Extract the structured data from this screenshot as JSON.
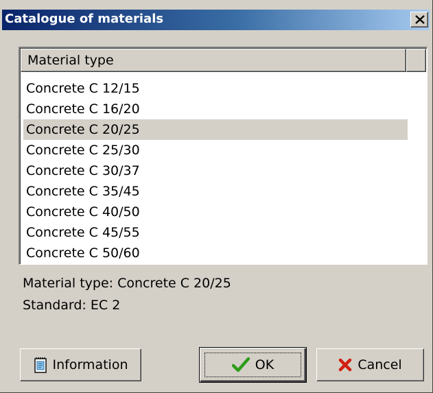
{
  "window": {
    "title": "Catalogue of materials"
  },
  "list": {
    "header": "Material type",
    "items": [
      "Concrete C 12/15",
      "Concrete C 16/20",
      "Concrete C 20/25",
      "Concrete C 25/30",
      "Concrete C 30/37",
      "Concrete C 35/45",
      "Concrete C 40/50",
      "Concrete C 45/55",
      "Concrete C 50/60"
    ],
    "selected_index": 2
  },
  "details": {
    "material_type": "Material type: Concrete C 20/25",
    "standard": "Standard: EC 2"
  },
  "buttons": {
    "information": "Information",
    "ok": "OK",
    "cancel": "Cancel"
  },
  "colors": {
    "title_gradient_start": "#0a246a",
    "title_gradient_end": "#a6caf0",
    "ok_check": "#2e9c1a",
    "cancel_x": "#d01f10",
    "face": "#d4d0c8"
  },
  "icons": {
    "close": "close-icon",
    "information": "notepad-icon",
    "ok": "checkmark-icon",
    "cancel": "x-icon"
  }
}
